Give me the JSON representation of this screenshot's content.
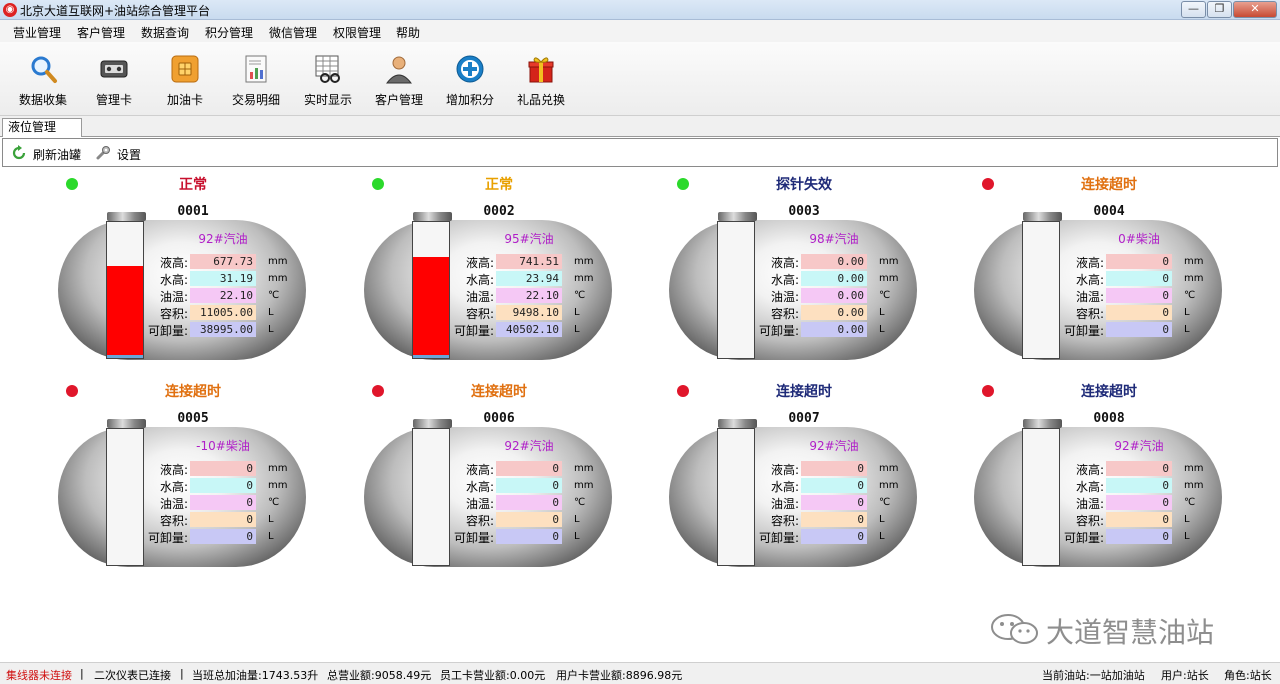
{
  "window": {
    "title": "北京大道互联网+油站综合管理平台",
    "controls": [
      "—",
      "❐",
      "✕"
    ]
  },
  "menu": [
    "营业管理",
    "客户管理",
    "数据查询",
    "积分管理",
    "微信管理",
    "权限管理",
    "帮助"
  ],
  "toolbar": [
    {
      "label": "数据收集",
      "icon": "magnifier-icon"
    },
    {
      "label": "管理卡",
      "icon": "card-reader-icon"
    },
    {
      "label": "加油卡",
      "icon": "chip-card-icon"
    },
    {
      "label": "交易明细",
      "icon": "report-icon"
    },
    {
      "label": "实时显示",
      "icon": "spreadsheet-glasses-icon"
    },
    {
      "label": "客户管理",
      "icon": "user-icon"
    },
    {
      "label": "增加积分",
      "icon": "plus-circle-icon"
    },
    {
      "label": "礼品兑换",
      "icon": "gift-icon"
    }
  ],
  "tab": {
    "label": "液位管理"
  },
  "actions": {
    "refresh": "刷新油罐",
    "settings": "设置"
  },
  "field_labels": [
    "液高:",
    "水高:",
    "油温:",
    "容积:",
    "可卸量:"
  ],
  "field_units": [
    "mm",
    "mm",
    "℃",
    "L",
    "L"
  ],
  "colors": {
    "green": "#2bd92b",
    "red": "#e0162b",
    "status_normal": "#c8102e",
    "status_warning": "#e8a000",
    "status_navy": "#1e2a78",
    "status_timeout_orange": "#e07010",
    "field_bg": [
      "#f7c8c8",
      "#c8f7f7",
      "#f5c8f5",
      "#fde0c0",
      "#c8c8f5"
    ]
  },
  "tanks": [
    {
      "id": "0001",
      "status": "正常",
      "status_color": "#c8102e",
      "dot": "#2bd92b",
      "oil": "92#汽油",
      "level_fraction": 0.68,
      "values": [
        "677.73",
        "31.19",
        "22.10",
        "11005.00",
        "38995.00"
      ]
    },
    {
      "id": "0002",
      "status": "正常",
      "status_color": "#e8a000",
      "dot": "#2bd92b",
      "oil": "95#汽油",
      "level_fraction": 0.74,
      "values": [
        "741.51",
        "23.94",
        "22.10",
        "9498.10",
        "40502.10"
      ]
    },
    {
      "id": "0003",
      "status": "探针失效",
      "status_color": "#1e2a78",
      "dot": "#2bd92b",
      "oil": "98#汽油",
      "level_fraction": 0,
      "values": [
        "0.00",
        "0.00",
        "0.00",
        "0.00",
        "0.00"
      ]
    },
    {
      "id": "0004",
      "status": "连接超时",
      "status_color": "#e07010",
      "dot": "#e0162b",
      "oil": "0#柴油",
      "level_fraction": 0,
      "values": [
        "0",
        "0",
        "0",
        "0",
        "0"
      ]
    },
    {
      "id": "0005",
      "status": "连接超时",
      "status_color": "#e07010",
      "dot": "#e0162b",
      "oil": "-10#柴油",
      "level_fraction": 0,
      "values": [
        "0",
        "0",
        "0",
        "0",
        "0"
      ]
    },
    {
      "id": "0006",
      "status": "连接超时",
      "status_color": "#e07010",
      "dot": "#e0162b",
      "oil": "92#汽油",
      "level_fraction": 0,
      "values": [
        "0",
        "0",
        "0",
        "0",
        "0"
      ]
    },
    {
      "id": "0007",
      "status": "连接超时",
      "status_color": "#1e2a78",
      "dot": "#e0162b",
      "oil": "92#汽油",
      "level_fraction": 0,
      "values": [
        "0",
        "0",
        "0",
        "0",
        "0"
      ]
    },
    {
      "id": "0008",
      "status": "连接超时",
      "status_color": "#1e2a78",
      "dot": "#e0162b",
      "oil": "92#汽油",
      "level_fraction": 0,
      "values": [
        "0",
        "0",
        "0",
        "0",
        "0"
      ]
    }
  ],
  "watermark": "大道智慧油站",
  "statusbar": {
    "collector": "集线器未连接",
    "sep": "|",
    "meter": "二次仪表已连接",
    "shift_volume": "当班总加油量:1743.53升",
    "total_sales": "总营业额:9058.49元",
    "staff_sales": "员工卡营业额:0.00元",
    "user_sales": "用户卡营业额:8896.98元",
    "station": "当前油站:一站加油站",
    "user": "用户:站长",
    "role": "角色:站长"
  }
}
